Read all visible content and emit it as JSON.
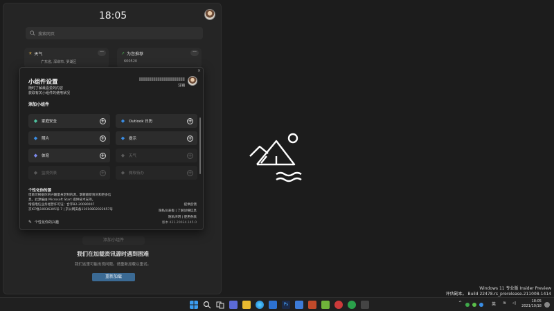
{
  "panel": {
    "clock": "18:05",
    "search_placeholder": "搜索网页",
    "weather_widget": {
      "title": "天气",
      "location": "广东省, 深圳市, 罗湖区"
    },
    "recommend_widget": {
      "title": "为您推荐",
      "snippet": "600520"
    },
    "add_widget_label": "添加小组件",
    "error_title": "我们在加载资讯源时遇到困难",
    "error_body": "我们这里可能出现问题。请重新加载以重试。",
    "retry_label": "重新加载"
  },
  "dialog": {
    "close": "×",
    "title": "小组件设置",
    "subtitle_1": "随时了解最喜爱的内容",
    "subtitle_2": "获取有关小组件的使用状况",
    "logout": "注销",
    "add_section": "添加小组件",
    "widgets": [
      {
        "label": "家庭安全",
        "icon": "family-safety-icon",
        "color": "#4fc3a1",
        "enabled": true
      },
      {
        "label": "Outlook 日历",
        "icon": "outlook-calendar-icon",
        "color": "#3a8ee6",
        "enabled": true
      },
      {
        "label": "照片",
        "icon": "photos-icon",
        "color": "#3a8ee6",
        "enabled": true
      },
      {
        "label": "提示",
        "icon": "tips-icon",
        "color": "#3a8ee6",
        "enabled": true
      },
      {
        "label": "体育",
        "icon": "sports-icon",
        "color": "#7e8cf0",
        "enabled": true
      },
      {
        "label": "天气",
        "icon": "weather-icon",
        "color": "#d4a53a",
        "enabled": false
      },
      {
        "label": "监视列表",
        "icon": "watchlist-icon",
        "color": "#3f9a4a",
        "enabled": false
      },
      {
        "label": "微软待办",
        "icon": "todo-icon",
        "color": "#3a6ee6",
        "enabled": false
      }
    ],
    "personalize_heading": "个性化你的源",
    "personalize_lines": [
      "借助可根据你的兴趣量身定制的源，掌握最新资讯和更多信",
      "息。此源编由 Microsoft Start 提供技术支持。",
      "增值电信业务经营许可证：合字B2-20090007",
      "京ICP备10036305号-7 | 京公网安备11010802022657号"
    ],
    "right_links": [
      "提供反馈",
      "隐私仪表板 | 了解详细信息",
      "隐私声明 | 使用条款",
      "版本 421.20034.145.0"
    ],
    "personalize_link": "个性化你的兴趣"
  },
  "watermark": {
    "line1": "Windows 11 专业版 Insider Preview",
    "line2": "评估副本。 Build 22478.rs_prerelease.211008-1414"
  },
  "taskbar": {
    "lang": "英",
    "time": "18:05",
    "date": "2021/10/18"
  }
}
